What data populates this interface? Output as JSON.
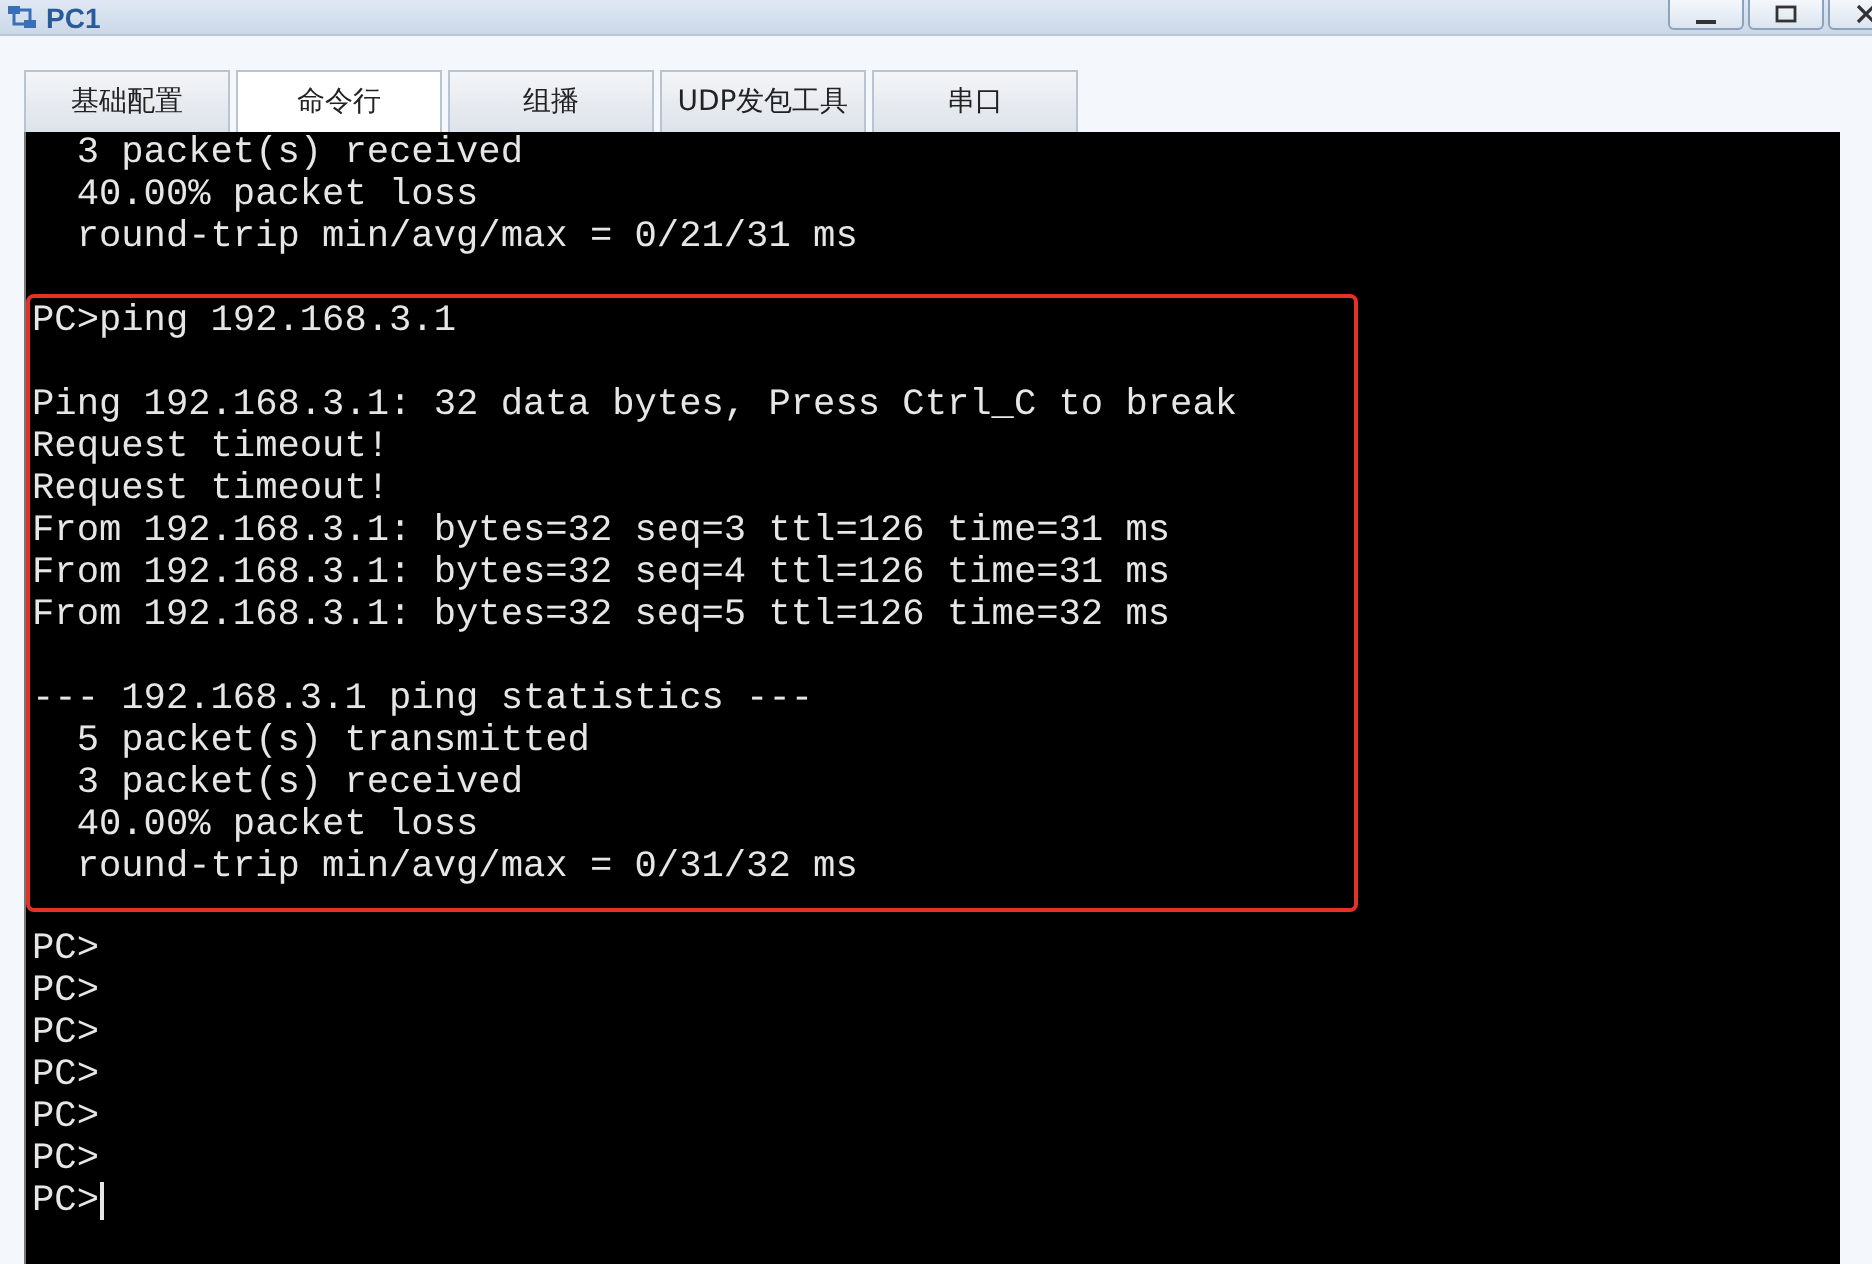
{
  "window": {
    "title": "PC1"
  },
  "tabs": [
    {
      "label": "基础配置",
      "selected": false
    },
    {
      "label": "命令行",
      "selected": true
    },
    {
      "label": "组播",
      "selected": false
    },
    {
      "label": "UDP发包工具",
      "selected": false
    },
    {
      "label": "串口",
      "selected": false
    }
  ],
  "terminal": {
    "sections": [
      {
        "highlighted": false,
        "blocks": [
          [
            "  3 packet(s) received",
            "  40.00% packet loss",
            "  round-trip min/avg/max = 0/21/31 ms"
          ]
        ]
      },
      {
        "highlighted": true,
        "blocks": [
          [
            "PC>ping 192.168.3.1"
          ],
          [
            "Ping 192.168.3.1: 32 data bytes, Press Ctrl_C to break",
            "Request timeout!",
            "Request timeout!",
            "From 192.168.3.1: bytes=32 seq=3 ttl=126 time=31 ms",
            "From 192.168.3.1: bytes=32 seq=4 ttl=126 time=31 ms",
            "From 192.168.3.1: bytes=32 seq=5 ttl=126 time=32 ms"
          ],
          [
            "--- 192.168.3.1 ping statistics ---",
            "  5 packet(s) transmitted",
            "  3 packet(s) received",
            "  40.00% packet loss",
            "  round-trip min/avg/max = 0/31/32 ms"
          ]
        ]
      },
      {
        "highlighted": false,
        "blocks": [
          [
            "PC>",
            "PC>",
            "PC>",
            "PC>",
            "PC>",
            "PC>",
            "PC>"
          ]
        ]
      }
    ],
    "cursor": true
  }
}
